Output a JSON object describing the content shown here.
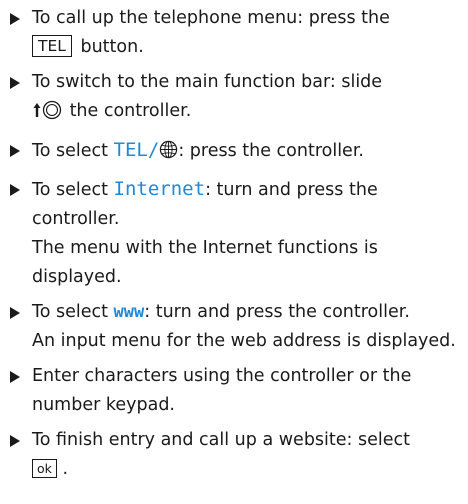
{
  "steps": [
    {
      "pre": "To call up the telephone menu: press the",
      "key": "TEL",
      "post": " button."
    },
    {
      "pre": "To switch to the main function bar: slide",
      "icon": "controller-slide-up-icon",
      "post": " the controller."
    },
    {
      "pre": "To select ",
      "highlight": "TEL/",
      "icon": "globe-icon",
      "post": ": press the controller."
    },
    {
      "pre": "To select ",
      "highlight": "Internet",
      "post": ": turn and press the controller.",
      "result": "The menu with the Internet functions is displayed."
    },
    {
      "pre": "To select ",
      "highlight": "www",
      "post": ": turn and press the controller.",
      "result": "An input menu for the web address is displayed."
    },
    {
      "pre": "Enter characters using the controller or the number keypad."
    },
    {
      "pre": "To finish entry and call up a website: select",
      "key": "ok",
      "post": " ."
    }
  ],
  "colors": {
    "highlight": "#1f88d8",
    "text": "#1a1a1a"
  }
}
